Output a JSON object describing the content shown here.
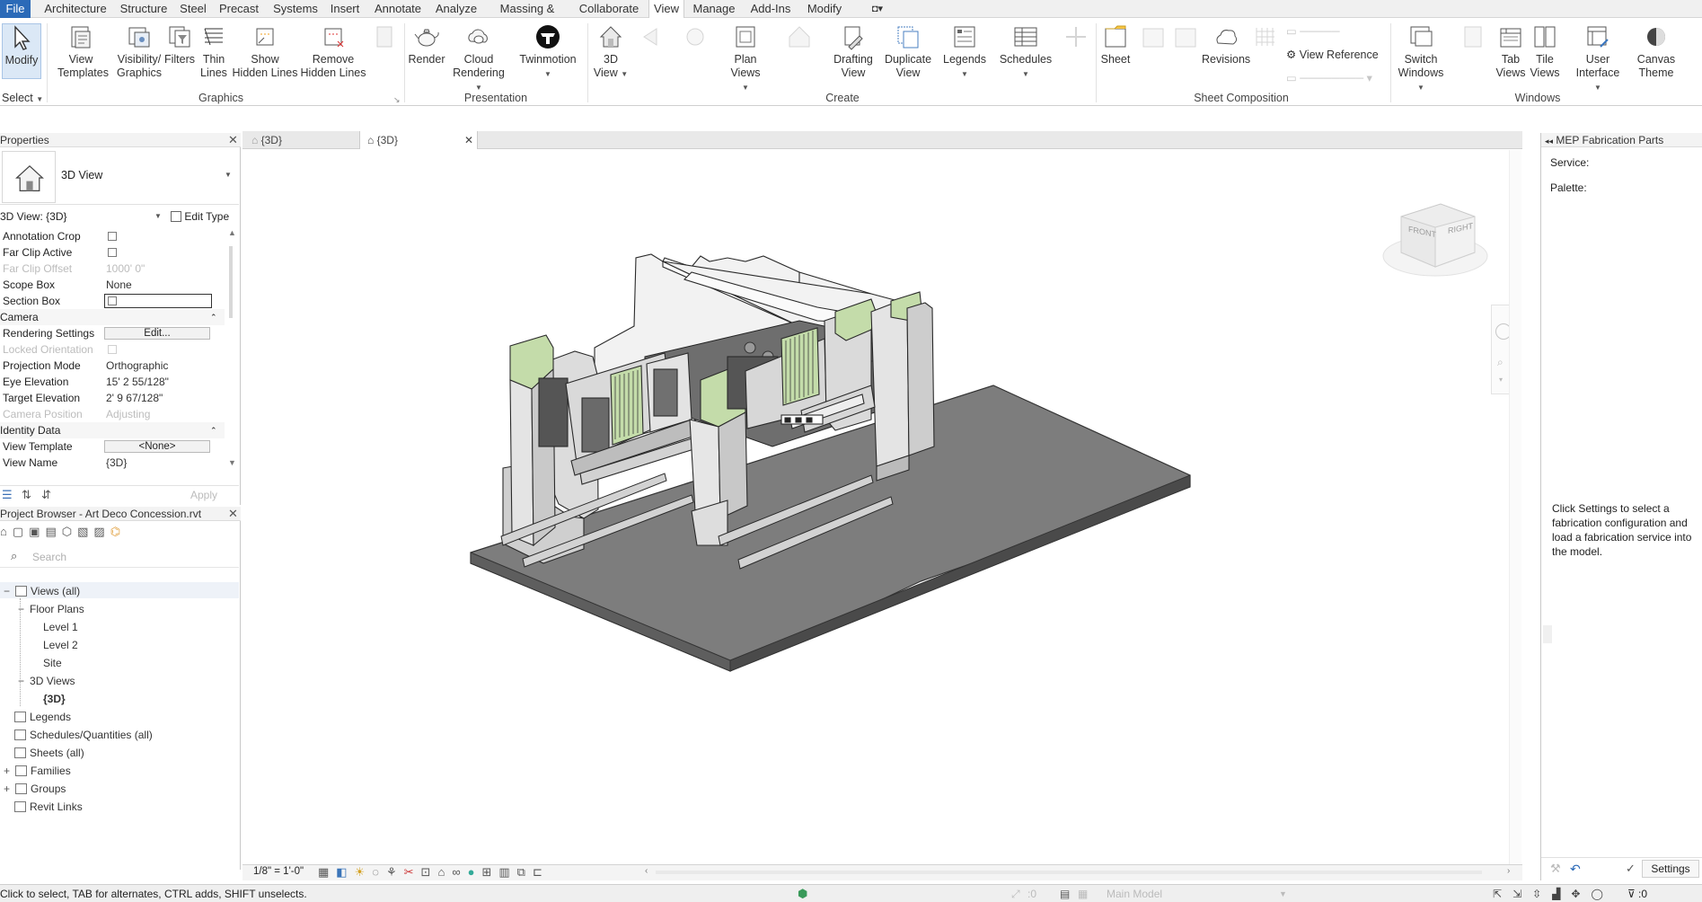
{
  "menu": {
    "tabs": [
      "File",
      "Architecture",
      "Structure",
      "Steel",
      "Precast",
      "Systems",
      "Insert",
      "Annotate",
      "Analyze",
      "Massing & Site",
      "Collaborate",
      "View",
      "Manage",
      "Add-Ins",
      "Modify"
    ],
    "active_tab": "View"
  },
  "ribbon": {
    "modify": "Modify",
    "select": "Select",
    "view_templates": [
      "View",
      "Templates"
    ],
    "visibility_graphics": [
      "Visibility/",
      "Graphics"
    ],
    "filters": "Filters",
    "thin_lines": [
      "Thin",
      "Lines"
    ],
    "show_hidden_lines": [
      "Show",
      "Hidden Lines"
    ],
    "remove_hidden_lines": [
      "Remove",
      "Hidden Lines"
    ],
    "render": "Render",
    "cloud_rendering": [
      "Cloud",
      "Rendering"
    ],
    "twinmotion": "Twinmotion",
    "three_d_view": [
      "3D",
      "View"
    ],
    "plan_views": [
      "Plan",
      "Views"
    ],
    "drafting_view": [
      "Drafting",
      "View"
    ],
    "duplicate_view": [
      "Duplicate",
      "View"
    ],
    "legends": "Legends",
    "schedules": "Schedules",
    "sheet": "Sheet",
    "revisions": "Revisions",
    "view_reference": "View  Reference",
    "switch_windows": [
      "Switch",
      "Windows"
    ],
    "tab_views": [
      "Tab",
      "Views"
    ],
    "tile_views": [
      "Tile",
      "Views"
    ],
    "user_interface": [
      "User",
      "Interface"
    ],
    "canvas_theme": [
      "Canvas",
      "Theme"
    ],
    "groups": [
      "Graphics",
      "Presentation",
      "Create",
      "Sheet Composition",
      "Windows"
    ]
  },
  "properties": {
    "title": "Properties",
    "type_name": "3D View",
    "instance_selector": "3D View: {3D}",
    "edit_type": "Edit Type",
    "rows": [
      {
        "k": "Annotation Crop",
        "v": "",
        "checkbox": true
      },
      {
        "k": "Far Clip Active",
        "v": "",
        "checkbox": true
      },
      {
        "k": "Far Clip Offset",
        "v": "1000'  0\"",
        "dim": true
      },
      {
        "k": "Scope Box",
        "v": "None"
      },
      {
        "k": "Section Box",
        "v": "",
        "checkbox": true,
        "boxed": true
      }
    ],
    "camera_header": "Camera",
    "camera_rows": [
      {
        "k": "Rendering Settings",
        "v": "Edit...",
        "button": true
      },
      {
        "k": "Locked Orientation",
        "v": "",
        "dim": true,
        "checkbox": true
      },
      {
        "k": "Projection Mode",
        "v": "Orthographic"
      },
      {
        "k": "Eye Elevation",
        "v": "15'  2 55/128\""
      },
      {
        "k": "Target Elevation",
        "v": "2'  9 67/128\""
      },
      {
        "k": "Camera Position",
        "v": "Adjusting",
        "dim": true
      }
    ],
    "identity_header": "Identity Data",
    "identity_rows": [
      {
        "k": "View Template",
        "v": "<None>",
        "button": true
      },
      {
        "k": "View Name",
        "v": "{3D}"
      }
    ],
    "apply": "Apply"
  },
  "browser": {
    "title": "Project Browser - Art Deco Concession.rvt",
    "search_placeholder": "Search",
    "items": [
      {
        "label": "Views (all)",
        "indent": 0,
        "expander": "−",
        "icon": true
      },
      {
        "label": "Floor Plans",
        "indent": 1,
        "expander": "−"
      },
      {
        "label": "Level 1",
        "indent": 2
      },
      {
        "label": "Level 2",
        "indent": 2
      },
      {
        "label": "Site",
        "indent": 2
      },
      {
        "label": "3D Views",
        "indent": 1,
        "expander": "−"
      },
      {
        "label": "{3D}",
        "indent": 2,
        "bold": true
      },
      {
        "label": "Legends",
        "indent": 0,
        "icon": true
      },
      {
        "label": "Schedules/Quantities (all)",
        "indent": 0,
        "icon": true
      },
      {
        "label": "Sheets (all)",
        "indent": 0,
        "icon": true
      },
      {
        "label": "Families",
        "indent": 0,
        "expander": "+",
        "icon": true
      },
      {
        "label": "Groups",
        "indent": 0,
        "expander": "+",
        "icon": true
      },
      {
        "label": "Revit Links",
        "indent": 0,
        "icon": true
      }
    ]
  },
  "view_tabs": [
    {
      "label": "{3D}",
      "active": false
    },
    {
      "label": "{3D}",
      "active": true
    }
  ],
  "viewcube": {
    "front": "FRONT",
    "right": "RIGHT"
  },
  "view_control": {
    "scale": "1/8\" = 1'-0\""
  },
  "mep": {
    "title": "MEP Fabrication Parts",
    "service_label": "Service:",
    "palette_label": "Palette:",
    "message": "Click Settings to select a fabrication configuration and load a fabrication service into the model.",
    "settings": "Settings"
  },
  "status": {
    "hint": "Click to select, TAB for alternates, CTRL adds, SHIFT unselects.",
    "zero": ":0",
    "model": "Main Model",
    "filter_count": ":0"
  },
  "colors": {
    "ribbon_active": "#2b6ab8",
    "building_light": "#e2e5e2",
    "building_accent": "#c4dcaa",
    "slab": "#7e7e7e"
  }
}
